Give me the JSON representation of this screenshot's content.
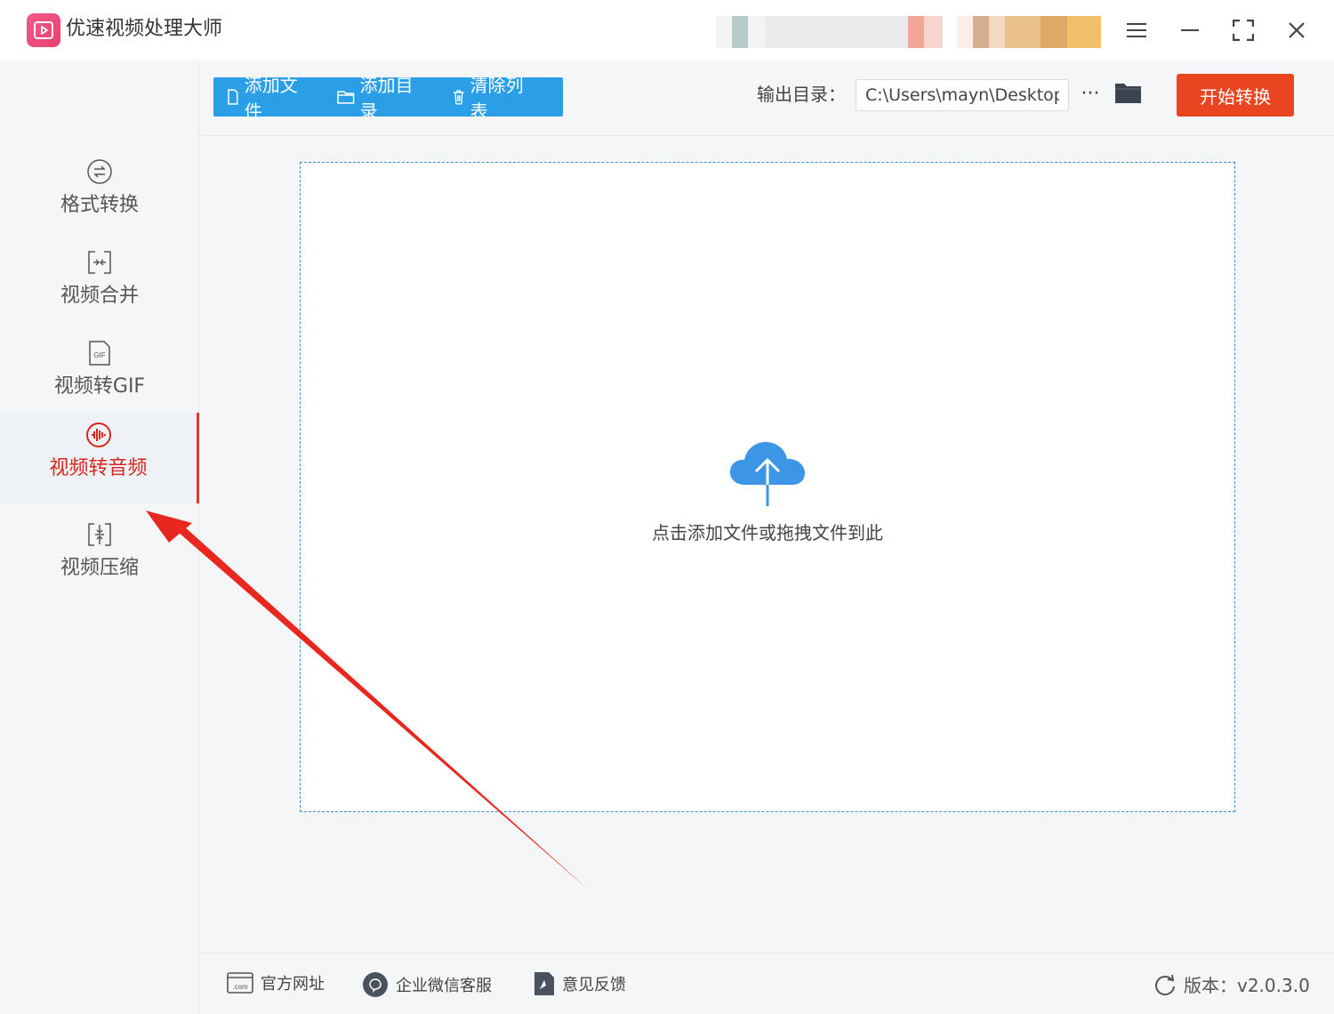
{
  "titlebar": {
    "app_title": "优速视频处理大师"
  },
  "sidebar": {
    "items": [
      {
        "label": "格式转换",
        "icon": "format-convert-icon"
      },
      {
        "label": "视频合并",
        "icon": "merge-icon"
      },
      {
        "label": "视频转GIF",
        "icon": "gif-icon"
      },
      {
        "label": "视频转音频",
        "icon": "audio-wave-icon",
        "active": true
      },
      {
        "label": "视频压缩",
        "icon": "compress-icon"
      }
    ]
  },
  "toolbar": {
    "add_file": "添加文件",
    "add_dir": "添加目录",
    "clear_list": "清除列表",
    "output_label": "输出目录：",
    "output_path": "C:\\Users\\mayn\\Desktop",
    "more": "···",
    "start": "开始转换"
  },
  "dropzone": {
    "hint": "点击添加文件或拖拽文件到此"
  },
  "footer": {
    "website": "官方网址",
    "wechat": "企业微信客服",
    "feedback": "意见反馈",
    "version": "版本：v2.0.3.0"
  },
  "colors": {
    "accent_blue": "#2b9ee8",
    "start_red": "#e84520",
    "active_red": "#d9261c",
    "annotation_arrow": "#e8281e"
  }
}
